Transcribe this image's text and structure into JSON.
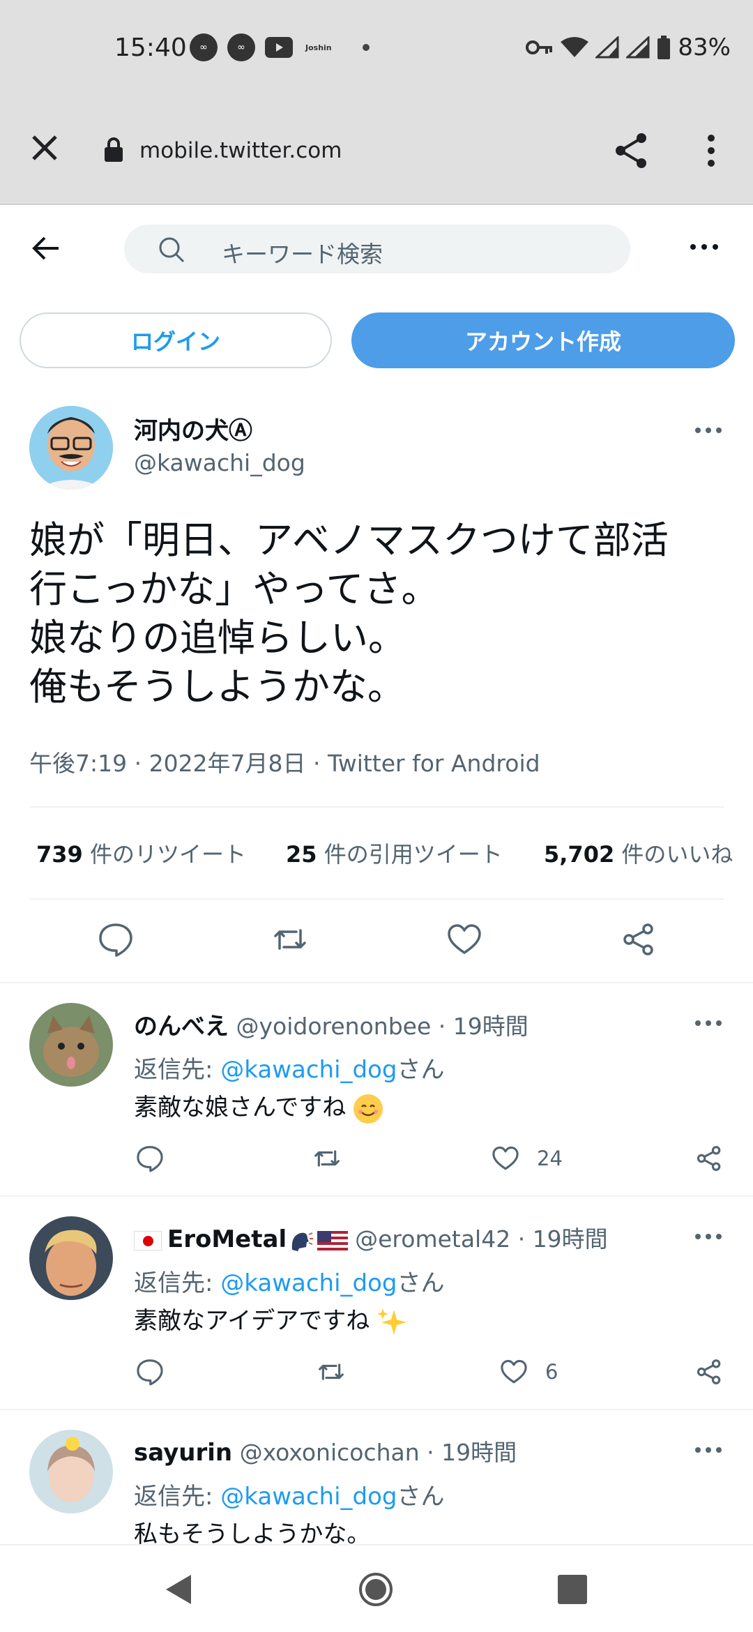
{
  "status_bar": {
    "time": "15:40",
    "notif_app_label": "Joshin",
    "battery": "83%",
    "icons": [
      "app-circle-icon",
      "app-circle-icon",
      "youtube-icon",
      "joshin-icon",
      "dot-icon",
      "key-icon",
      "wifi-icon",
      "signal-icon",
      "battery-icon"
    ]
  },
  "browser": {
    "url": "mobile.twitter.com"
  },
  "header": {
    "search_placeholder": "キーワード検索"
  },
  "auth": {
    "login_label": "ログイン",
    "signup_label": "アカウント作成"
  },
  "tweet": {
    "author_name": "河内の犬Ⓐ",
    "author_handle": "@kawachi_dog",
    "text": "娘が「明日、アベノマスクつけて部活\n行こっかな」やってさ。\n娘なりの追悼らしい。\n俺もそうしようかな。",
    "meta": "午後7:19 · 2022年7月8日 · Twitter for Android",
    "stats": {
      "retweets_count": "739",
      "retweets_label": " 件のリツイート",
      "quotes_count": "25",
      "quotes_label": " 件の引用ツイート",
      "likes_count": "5,702",
      "likes_label": " 件のいいね"
    }
  },
  "replies": [
    {
      "name": "のんべえ",
      "handle": "@yoidorenonbee",
      "time": " · 19時間",
      "reply_prefix": "返信先: ",
      "mention": "@kawachi_dog",
      "reply_suffix": "さん",
      "text": "素敵な娘さんですね",
      "likes": "24"
    },
    {
      "name": "EroMetal",
      "handle": "@erometal42",
      "time": " · 19時間",
      "reply_prefix": "返信先: ",
      "mention": "@kawachi_dog",
      "reply_suffix": "さん",
      "text": "素敵なアイデアですね",
      "likes": "6"
    },
    {
      "name": "sayurin",
      "handle": "@xoxonicochan",
      "time": " · 19時間",
      "reply_prefix": "返信先: ",
      "mention": "@kawachi_dog",
      "reply_suffix": "さん",
      "text": "私もそうしようかな。"
    }
  ],
  "colors": {
    "accent": "#1d9bf0",
    "signup_bg": "#4d9de9",
    "text_primary": "#0f1419",
    "text_secondary": "#536471",
    "chrome_bg": "#e0e0e0"
  }
}
